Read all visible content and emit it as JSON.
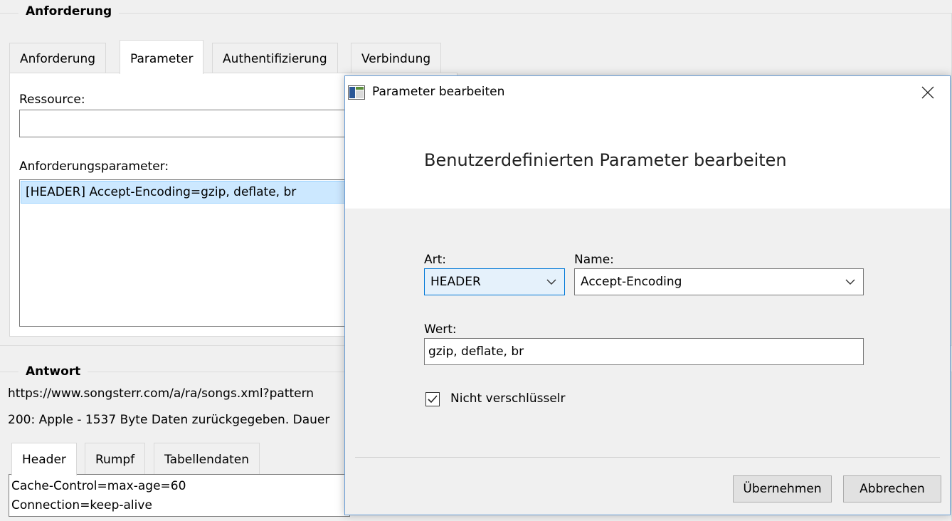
{
  "request_group": {
    "title": "Anforderung",
    "tabs": [
      "Anforderung",
      "Parameter",
      "Authentifizierung",
      "Verbindung"
    ],
    "active_tab": "Parameter",
    "resource_label": "Ressource:",
    "resource_value": "",
    "params_label": "Anforderungsparameter:",
    "params": [
      "[HEADER] Accept-Encoding=gzip, deflate, br"
    ]
  },
  "response_group": {
    "title": "Antwort",
    "url_line": "https://www.songsterr.com/a/ra/songs.xml?pattern",
    "status_line": "200: Apple - 1537 Byte Daten zurückgegeben. Dauer",
    "tabs": [
      "Header",
      "Rumpf",
      "Tabellendaten"
    ],
    "active_tab": "Header",
    "headers": [
      "Cache-Control=max-age=60",
      "Connection=keep-alive"
    ]
  },
  "dialog": {
    "title": "Parameter bearbeiten",
    "heading": "Benutzerdefinierten Parameter bearbeiten",
    "type_label": "Art:",
    "type_value": "HEADER",
    "name_label": "Name:",
    "name_value": "Accept-Encoding",
    "value_label": "Wert:",
    "value_value": "gzip, deflate, br",
    "checkbox_label": "Nicht verschlüsselr",
    "checkbox_checked": true,
    "apply_button": "Übernehmen",
    "cancel_button": "Abbrechen",
    "close_icon": "close-icon",
    "app_icon": "window-app-icon"
  },
  "colors": {
    "selection_bg": "#cce8ff",
    "selection_border": "#99d1ff",
    "accent": "#0078d7"
  }
}
